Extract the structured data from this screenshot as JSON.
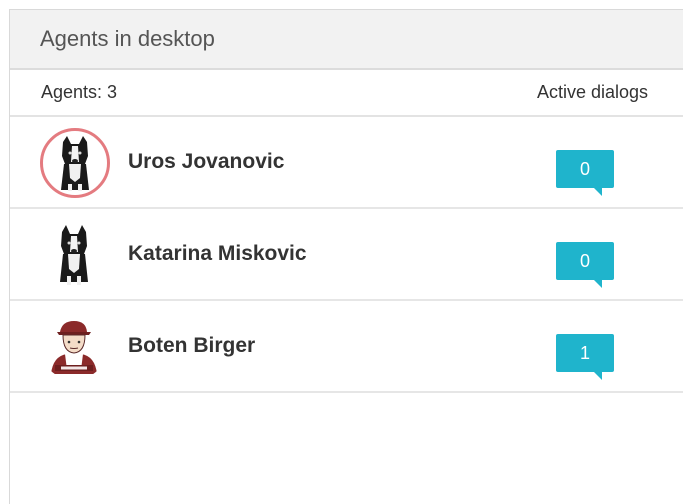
{
  "panel": {
    "title": "Agents in desktop"
  },
  "columns": {
    "agents_count": "Agents: 3",
    "active_dialogs": "Active dialogs"
  },
  "agents": [
    {
      "name": "Uros Jovanovic",
      "active_dialogs": "0",
      "avatar": "border-collie-dog-icon",
      "status": "online"
    },
    {
      "name": "Katarina Miskovic",
      "active_dialogs": "0",
      "avatar": "border-collie-dog-icon",
      "status": "none"
    },
    {
      "name": "Boten Birger",
      "active_dialogs": "1",
      "avatar": "bot-character-icon",
      "status": "none"
    }
  ],
  "colors": {
    "accent": "#1fb4cc",
    "online_ring": "#e47b80",
    "header_bg": "#f2f2f2"
  }
}
